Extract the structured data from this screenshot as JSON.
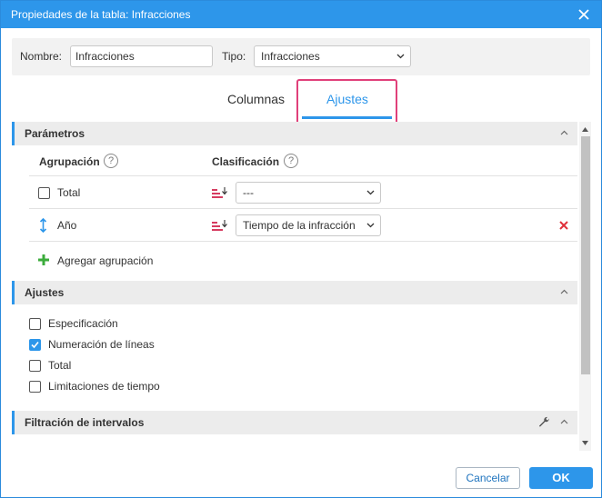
{
  "window": {
    "title": "Propiedades de la tabla: Infracciones"
  },
  "form": {
    "name_label": "Nombre:",
    "name_value": "Infracciones",
    "type_label": "Tipo:",
    "type_value": "Infracciones"
  },
  "tabs": [
    {
      "label": "Columnas",
      "active": false
    },
    {
      "label": "Ajustes",
      "active": true
    }
  ],
  "parametros": {
    "title": "Parámetros",
    "grouping_header": "Agrupación",
    "sorting_header": "Clasificación",
    "rows": [
      {
        "label": "Total",
        "sort_value": "---"
      },
      {
        "label": "Año",
        "sort_value": "Tiempo de la infracción"
      }
    ],
    "add_label": "Agregar agrupación"
  },
  "ajustes": {
    "title": "Ajustes",
    "options": [
      {
        "label": "Especificación",
        "checked": false
      },
      {
        "label": "Numeración de líneas",
        "checked": true
      },
      {
        "label": "Total",
        "checked": false
      },
      {
        "label": "Limitaciones de tiempo",
        "checked": false
      }
    ]
  },
  "filtracion": {
    "title": "Filtración de intervalos"
  },
  "footer": {
    "cancel_label": "Cancelar",
    "ok_label": "OK"
  },
  "colors": {
    "accent": "#2d96ea",
    "highlight": "#e0407a",
    "delete": "#e0303a",
    "add": "#3cac3c"
  }
}
